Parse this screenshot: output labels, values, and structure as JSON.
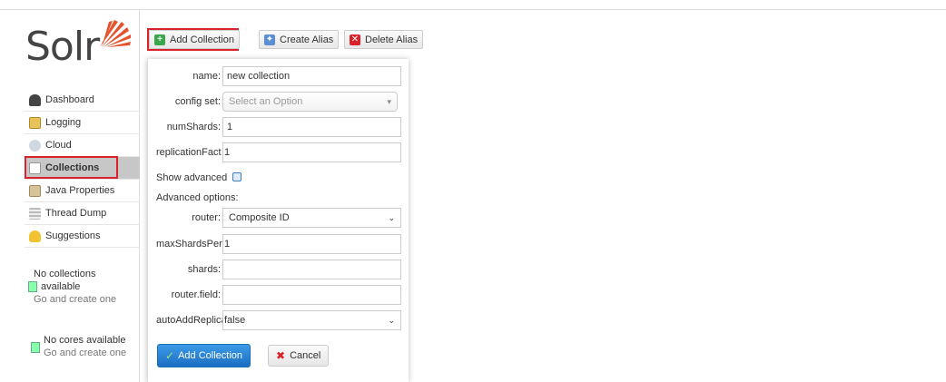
{
  "logo": {
    "text": "Solr"
  },
  "sidebar": {
    "items": [
      {
        "label": "Dashboard",
        "icon": "dashboard-icon",
        "active": false
      },
      {
        "label": "Logging",
        "icon": "logging-icon",
        "active": false
      },
      {
        "label": "Cloud",
        "icon": "cloud-icon",
        "active": false
      },
      {
        "label": "Collections",
        "icon": "collections-icon",
        "active": true
      },
      {
        "label": "Java Properties",
        "icon": "java-properties-icon",
        "active": false
      },
      {
        "label": "Thread Dump",
        "icon": "thread-dump-icon",
        "active": false
      },
      {
        "label": "Suggestions",
        "icon": "suggestions-icon",
        "active": false
      }
    ],
    "collections_note": {
      "line1": "No collections",
      "line2": "available",
      "line3": "Go and create one"
    },
    "cores_note": {
      "line1": "No cores available",
      "line2": "Go and create one"
    }
  },
  "toolbar": {
    "add_collection": "Add Collection",
    "create_alias": "Create Alias",
    "delete_alias": "Delete Alias"
  },
  "form": {
    "name_label": "name:",
    "name_value": "new collection",
    "config_set_label": "config set:",
    "config_set_placeholder": "Select an Option",
    "num_shards_label": "numShards:",
    "num_shards_value": "1",
    "replication_label": "replicationFact",
    "replication_value": "1",
    "show_advanced": "Show advanced",
    "advanced_options": "Advanced options:",
    "router_label": "router:",
    "router_value": "Composite ID",
    "max_shards_label": "maxShardsPer",
    "max_shards_value": "1",
    "shards_label": "shards:",
    "shards_value": "",
    "router_field_label": "router.field:",
    "router_field_value": "",
    "auto_add_label": "autoAddReplica",
    "auto_add_value": "false",
    "submit_label": "Add Collection",
    "cancel_label": "Cancel"
  },
  "colors": {
    "highlight": "#d9222a",
    "primary": "#1b6ec2",
    "logo_accent": "#e5502d"
  }
}
